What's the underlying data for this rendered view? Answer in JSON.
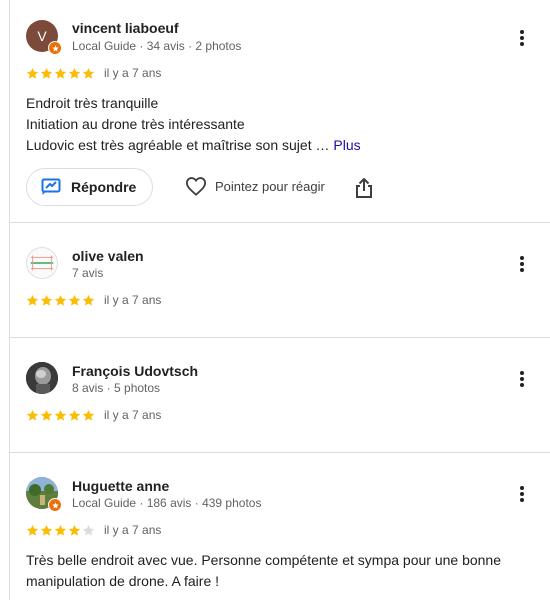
{
  "colors": {
    "star_filled": "#fbbc04",
    "star_empty": "#dadce0",
    "link": "#1a0dab",
    "guide_badge": "#e8710a"
  },
  "reviews": [
    {
      "avatar_letter": "V",
      "avatar_color": "#7b4a3a",
      "author": "vincent liaboeuf",
      "meta": "Local Guide · 34 avis · 2 photos",
      "rating": 5,
      "time": "il y a 7 ans",
      "lines": [
        "Endroit très tranquille",
        "Initiation au drone très intéressante",
        "Ludovic est très agréable et maîtrise son sujet …"
      ],
      "more_label": "Plus",
      "reply_label": "Répondre",
      "react_label": "Pointez pour réagir"
    },
    {
      "author": "olive valen",
      "meta": "7 avis",
      "rating": 5,
      "time": "il y a 7 ans"
    },
    {
      "author": "François Udovtsch",
      "meta": "8 avis · 5 photos",
      "rating": 5,
      "time": "il y a 7 ans"
    },
    {
      "author": "Huguette anne",
      "meta": "Local Guide · 186 avis · 439 photos",
      "rating": 4,
      "time": "il y a 7 ans",
      "lines": [
        "Très belle endroit avec vue. Personne compétente et sympa pour une bonne",
        "manipulation de drone. A faire !"
      ]
    }
  ]
}
